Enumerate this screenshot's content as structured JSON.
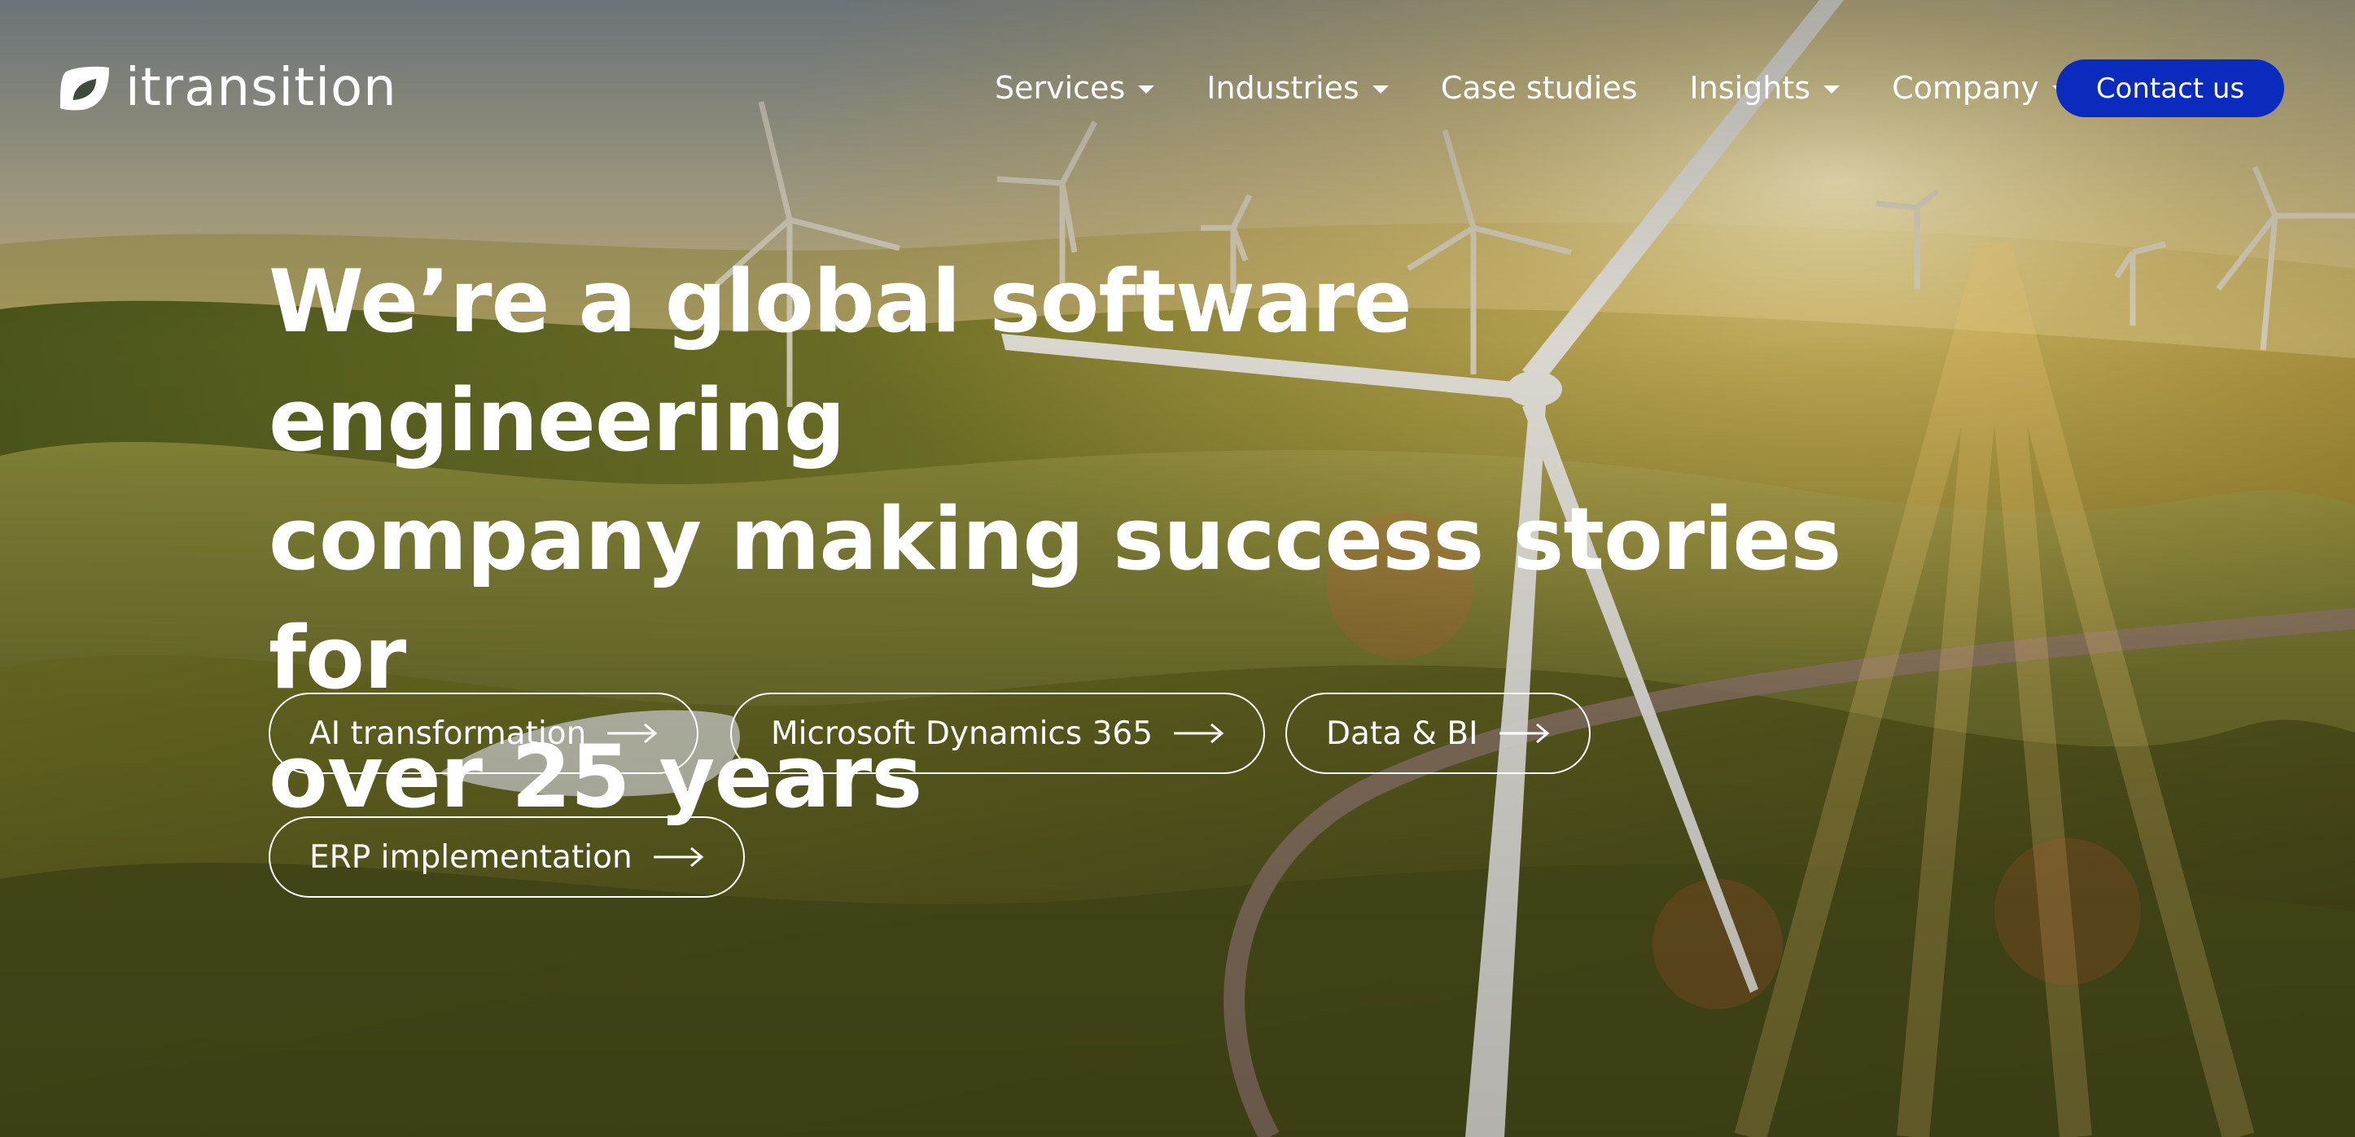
{
  "brand": {
    "name": "itransition",
    "logo_icon": "leaf-shield-icon"
  },
  "nav": {
    "items": [
      {
        "label": "Services",
        "has_dropdown": true
      },
      {
        "label": "Industries",
        "has_dropdown": true
      },
      {
        "label": "Case studies",
        "has_dropdown": false
      },
      {
        "label": "Insights",
        "has_dropdown": true
      },
      {
        "label": "Company",
        "has_dropdown": true
      }
    ],
    "contact_label": "Contact us"
  },
  "hero": {
    "title_lines": [
      "We’re a global software engineering",
      "company making success stories for",
      "over 25 years"
    ],
    "chips": [
      {
        "label": "AI transformation",
        "icon": "arrow-right-icon"
      },
      {
        "label": "Microsoft Dynamics 365",
        "icon": "arrow-right-icon"
      },
      {
        "label": "Data & BI",
        "icon": "arrow-right-icon"
      },
      {
        "label": "ERP implementation",
        "icon": "arrow-right-icon"
      }
    ]
  },
  "colors": {
    "contact_button": "#0a2bbd",
    "text": "#ffffff",
    "sky_top": "#8f9aa0",
    "sun_glow": "#f2dc8a",
    "hills": "#6b6a24"
  }
}
